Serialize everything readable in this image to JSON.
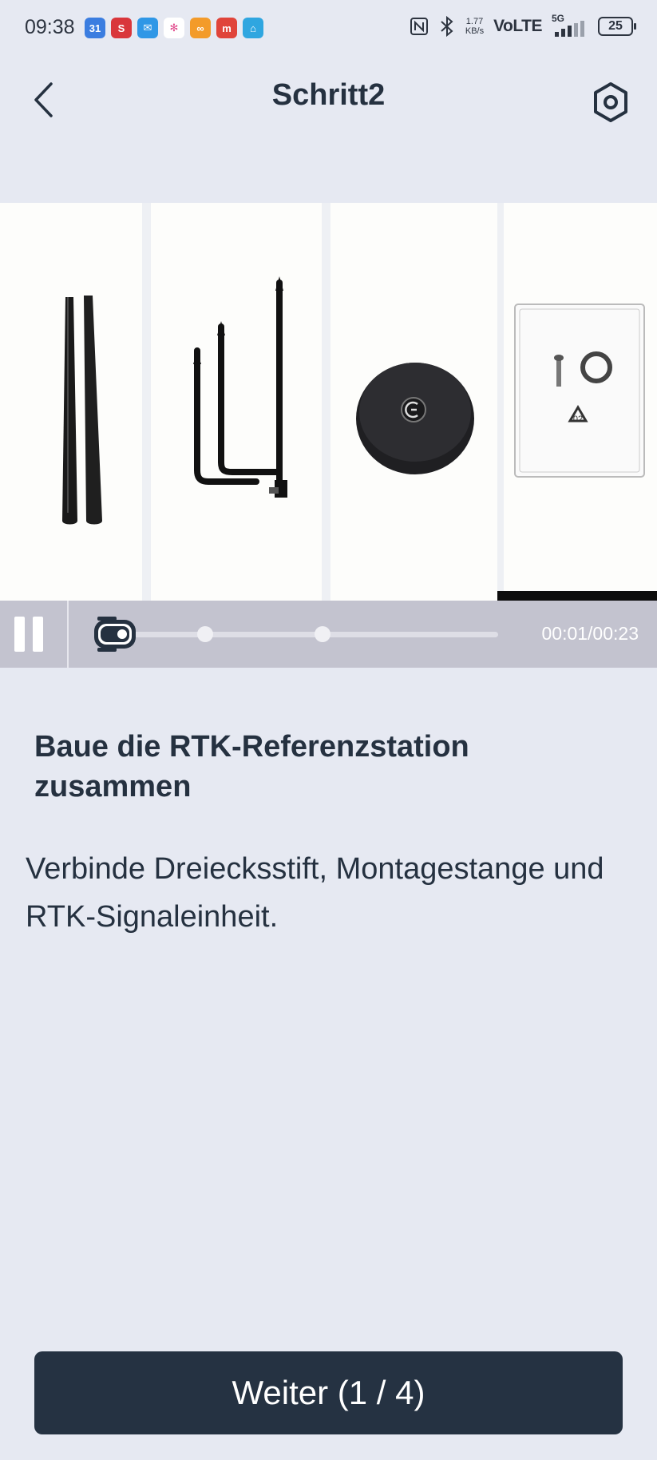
{
  "status_bar": {
    "time": "09:38",
    "notifications": [
      {
        "icon": "calendar-icon",
        "label": "31",
        "color": "#3b7de0"
      },
      {
        "icon": "s-app-icon",
        "label": "S",
        "color": "#d9363b"
      },
      {
        "icon": "mail-icon",
        "label": "✉",
        "color": "#2f97e6"
      },
      {
        "icon": "pinwheel-icon",
        "label": "✻",
        "color": "#ffffff"
      },
      {
        "icon": "link-icon",
        "label": "∞",
        "color": "#f39b2a"
      },
      {
        "icon": "app-icon",
        "label": "m",
        "color": "#e0443a"
      },
      {
        "icon": "home-icon",
        "label": "⌂",
        "color": "#2fa6e0"
      }
    ],
    "net_speed_value": "1.77",
    "net_speed_unit": "KB/s",
    "volte": "VoLTE",
    "network": "5G",
    "battery": "25"
  },
  "header": {
    "title": "Schritt2"
  },
  "video": {
    "time": "00:01/00:23",
    "progress": 0.04
  },
  "content": {
    "heading": "Baue die RTK-Referenzstation zusammen",
    "description": "Verbinde Dreiecksstift, Montagestange und RTK-Signaleinheit."
  },
  "footer": {
    "next_label": "Weiter (1 / 4)"
  }
}
